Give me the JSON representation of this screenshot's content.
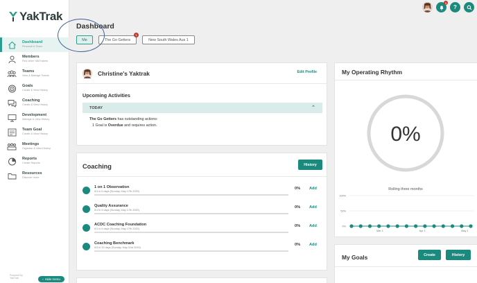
{
  "app": {
    "logo_text": "YakTrak"
  },
  "colors": {
    "accent": "#1a8a7e",
    "badge": "#c0392b",
    "highlight_ring": "#3f5f9a",
    "today_bg": "#d9ecea"
  },
  "sidebar": {
    "items": [
      {
        "label": "Dashboard",
        "sub": "Personal & Team",
        "icon": "home-icon",
        "active": true
      },
      {
        "label": "Members",
        "sub": "Find other YakTrakers",
        "icon": "person-icon"
      },
      {
        "label": "Teams",
        "sub": "View & Manage Teams",
        "icon": "team-icon"
      },
      {
        "label": "Goals",
        "sub": "Create & View History",
        "icon": "target-icon"
      },
      {
        "label": "Coaching",
        "sub": "Create & View History",
        "icon": "chat-icon"
      },
      {
        "label": "Development",
        "sub": "Manage & View History",
        "icon": "development-icon"
      },
      {
        "label": "Team Goal",
        "sub": "Create & View History",
        "icon": "team-goal-icon"
      },
      {
        "label": "Meetings",
        "sub": "Organise & View History",
        "icon": "meetings-icon"
      },
      {
        "label": "Reports",
        "sub": "Create Reports",
        "icon": "reports-icon"
      },
      {
        "label": "Resources",
        "sub": "Discover more",
        "icon": "folder-icon"
      }
    ],
    "powered_by": "Powered by",
    "powered_name": "YakTrak",
    "hide_menu": "Hide menu"
  },
  "header": {
    "notification_count": "1",
    "help_icon": "?",
    "search_icon": "search-icon"
  },
  "dashboard": {
    "title": "Dashboard",
    "tabs": [
      {
        "label": "Me",
        "active": true
      },
      {
        "label": "The Go Getters",
        "badge": "1"
      },
      {
        "label": "New South Wales Aus 1"
      }
    ]
  },
  "profile": {
    "name": "Christine's Yaktrak",
    "edit": "Edit Profile",
    "upcoming_title": "Upcoming Activities",
    "today_label": "TODAY",
    "activity_team": "The Go Getters",
    "activity_text": " has outstanding actions:",
    "activity_count": "1 Goal is ",
    "activity_status": "Overdue",
    "activity_tail": " and requires action."
  },
  "coaching": {
    "title": "Coaching",
    "history": "History",
    "rows": [
      {
        "name": "1 on 1 Observation",
        "sub": "0/1 in 6 days (Sunday, May 17th 2020)",
        "pct": "0%",
        "add": "Add",
        "progress": 0
      },
      {
        "name": "Quality Assurance",
        "sub": "0/1 in 6 days (Sunday, May 17th 2020)",
        "pct": "0%",
        "add": "Add",
        "progress": 0
      },
      {
        "name": "ACDC Coaching Foundation",
        "sub": "0/1 in 6 days (Sunday, May 17th 2020)",
        "pct": "0%",
        "add": "Add",
        "progress": 0
      },
      {
        "name": "Coaching Benchmark",
        "sub": "0/3 in 20 days (Sunday, May 31st 2020)",
        "pct": "0%",
        "add": "Add",
        "progress": 0
      }
    ]
  },
  "rhythm": {
    "title": "My Operating Rhythm",
    "value": "0%",
    "caption": "Rolling three months"
  },
  "chart_data": {
    "type": "line",
    "title": "",
    "xlabel": "",
    "ylabel": "",
    "ylim": [
      0,
      100
    ],
    "yticks": [
      "100%",
      "50%",
      "0%"
    ],
    "x_tick_labels": [
      "Mar 1",
      "Apr 1",
      "May 1"
    ],
    "series": [
      {
        "values": [
          0,
          0,
          0,
          0,
          0,
          0,
          0,
          0,
          0,
          0,
          0,
          0,
          0,
          0
        ]
      }
    ]
  },
  "goals": {
    "title": "My Goals",
    "create": "Create",
    "history": "History"
  }
}
